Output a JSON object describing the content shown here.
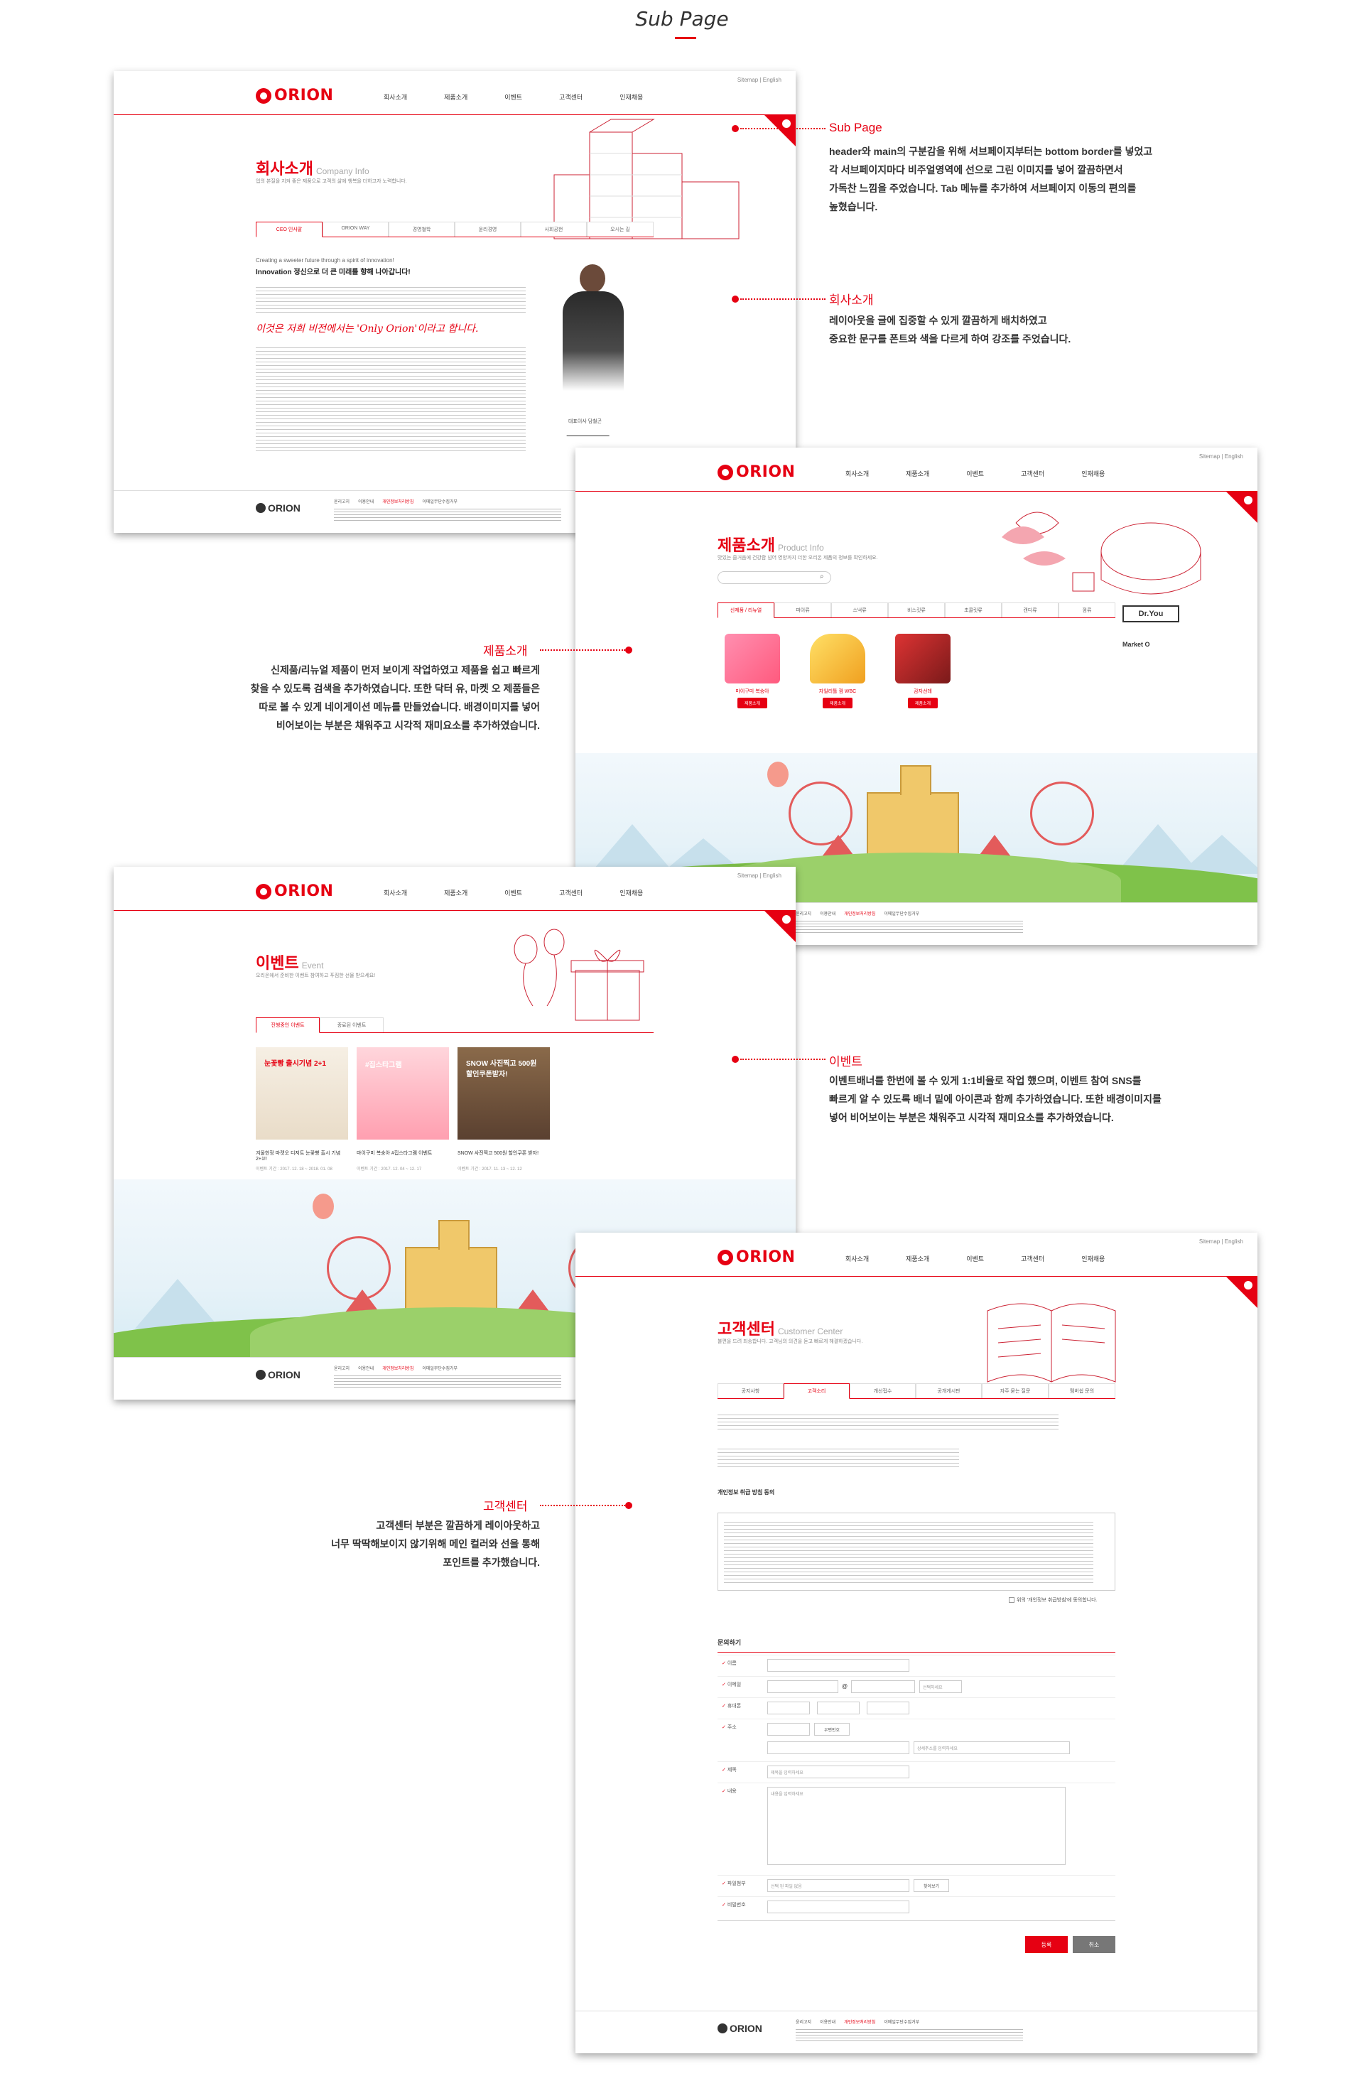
{
  "board": {
    "title": "Sub Page"
  },
  "common": {
    "logo": "ORION",
    "util_links": "Sitemap | English",
    "nav": [
      "회사소개",
      "제품소개",
      "이벤트",
      "고객센터",
      "인재채용"
    ],
    "footer_links": [
      "윤리고지",
      "이용안내",
      "개인정보처리방침",
      "이메일무단수집거부"
    ]
  },
  "company": {
    "title": "회사소개",
    "title_en": "Company Info",
    "desc": "업의 본질을 지켜 좋은 제품으로 고객의 삶에 행복을 더하고자 노력합니다.",
    "tabs": [
      "CEO 인사말",
      "ORION WAY",
      "경영철학",
      "윤리경영",
      "사회공헌",
      "오시는 길"
    ],
    "slogan_en": "Creating a sweeter future through a spirit of innovation!",
    "slogan_ko": "Innovation 정신으로 더 큰 미래를 향해 나아갑니다!",
    "script_quote": "이것은 저희 비전에서는 'Only Orion'이라고 합니다.",
    "ceo_name": "대표이사 담철곤"
  },
  "product": {
    "title": "제품소개",
    "title_en": "Product Info",
    "desc": "맛있는 즐거움에 건강함 넘어 영양까지 더한 오리온 제품의 정보를 확인하세요.",
    "tabs": [
      "신제품 / 리뉴얼",
      "파이류",
      "스낵류",
      "비스킷류",
      "초콜릿류",
      "캔디류",
      "껌류"
    ],
    "items": [
      {
        "name": "마이구미 복숭아",
        "btn": "제품소개"
      },
      {
        "name": "자일리톨 껌 WBC",
        "btn": "제품소개"
      },
      {
        "name": "감자선데",
        "btn": "제품소개"
      }
    ],
    "side": {
      "brand1": "Dr.You",
      "brand2": "Market O"
    }
  },
  "event": {
    "title": "이벤트",
    "title_en": "Event",
    "desc": "오리온에서 준비한 이벤트 참여하고 푸짐한 선물 받으세요!",
    "tabs": [
      "진행중인 이벤트",
      "종료된 이벤트"
    ],
    "banners": [
      {
        "cap": "겨울한정 마켓오 디저트 눈꽃빵 출시 기념 2+1!!",
        "date": "이벤트 기간 : 2017. 12. 18 ~ 2018. 01. 08"
      },
      {
        "cap": "마이구미 복숭아 #집스타그램 이벤트",
        "date": "이벤트 기간 : 2017. 12. 04 ~ 12. 17"
      },
      {
        "cap": "SNOW 사진찍고 500원 할인쿠폰 받자!",
        "date": "이벤트 기간 : 2017. 11. 13 ~ 12. 12"
      }
    ],
    "banner_texts": [
      "눈꽃빵 출시기념 2+1",
      "#집스타그램",
      "SNOW 사진찍고 500원할인쿠폰받자!"
    ]
  },
  "customer": {
    "title": "고객센터",
    "title_en": "Customer Center",
    "desc": "불편을 드려 죄송합니다. 고객님의 의견을 듣고 빠르게 해결하겠습니다.",
    "tabs": [
      "공지사항",
      "고객소리",
      "개선접수",
      "공개게시판",
      "자주 묻는 질문",
      "멤버쉽 문의"
    ],
    "privacy_title": "개인정보 취급 방침 동의",
    "agree_label": "위의 '개인정보 취급방침'에 동의합니다.",
    "form_title": "문의하기",
    "fields": [
      "이름",
      "이메일",
      "휴대폰",
      "주소",
      "제목",
      "내용",
      "파일첨부",
      "비밀번호"
    ],
    "placeholders": {
      "title": "제목을 입력하세요",
      "content": "내용을 입력하세요",
      "address2": "상세주소를 입력하세요",
      "file": "선택 된 파일 없음"
    },
    "zip_btn": "우편번호",
    "email_select": "선택하세요",
    "find_btn": "찾아보기",
    "submit": "등록",
    "cancel": "취소"
  },
  "notes": {
    "subpage": {
      "title": "Sub Page",
      "lines": [
        "header와 main의 구분감을 위해 서브페이지부터는 bottom border를 넣었고",
        "각 서브페이지마다 비주얼영역에 선으로 그린 이미지를 넣어 깔끔하면서",
        "가독찬 느낌을 주었습니다. Tab 메뉴를 추가하여 서브페이지 이동의 편의를",
        "높혔습니다."
      ]
    },
    "company": {
      "title": "회사소개",
      "lines": [
        "레이아웃을 글에 집중할 수 있게 깔끔하게 배치하였고",
        "중요한 문구를 폰트와 색을 다르게 하여 강조를 주었습니다."
      ]
    },
    "product": {
      "title": "제품소개",
      "lines": [
        "신제품/리뉴얼 제품이 먼저 보이게 작업하였고 제품을 쉽고 빠르게",
        "찾을 수 있도록 검색을 추가하였습니다. 또한 닥터 유, 마켓 오 제품들은",
        "따로 볼 수 있게 네이게이션 메뉴를 만들었습니다. 배경이미지를 넣어",
        "비어보이는 부분은 채워주고 시각적 재미요소를 추가하였습니다."
      ]
    },
    "event": {
      "title": "이벤트",
      "lines": [
        "이벤트배너를 한번에 볼 수 있게 1:1비율로 작업 했으며, 이벤트 참여 SNS를",
        "빠르게 알 수 있도록 배너 밑에 아이콘과 함께 추가하였습니다. 또한 배경이미지를",
        "넣어 비어보이는 부분은 채워주고 시각적 재미요소를 추가하였습니다."
      ]
    },
    "customer": {
      "title": "고객센터",
      "lines": [
        "고객센터 부분은 깔끔하게 레이아웃하고",
        "너무 딱딱해보이지 않기위해 메인 컬러와 선을 통해",
        "포인트를 추가했습니다."
      ]
    }
  },
  "colors": {
    "accent": "#e60012",
    "grass": "#7fc24a",
    "sky": "#e6f2f8"
  }
}
